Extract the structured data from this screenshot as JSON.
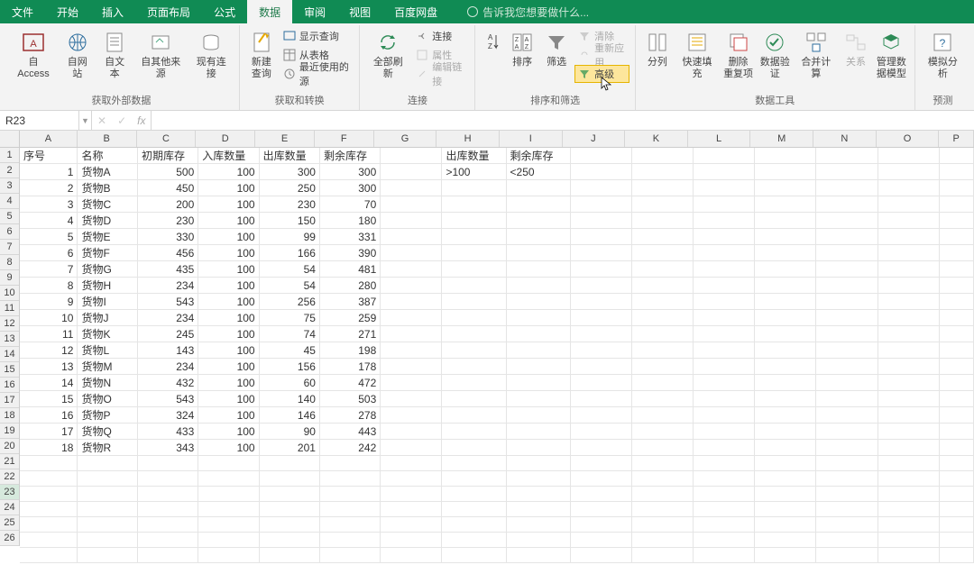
{
  "menu": {
    "file": "文件",
    "home": "开始",
    "insert": "插入",
    "layout": "页面布局",
    "formula": "公式",
    "data": "数据",
    "review": "审阅",
    "view": "视图",
    "baidu": "百度网盘",
    "tell": "告诉我您想要做什么..."
  },
  "ribbon": {
    "ext_data": {
      "access": "自 Access",
      "web": "自网站",
      "text": "自文本",
      "other": "自其他来源",
      "existing": "现有连接",
      "label": "获取外部数据"
    },
    "get_transform": {
      "newquery": "新建\n查询",
      "show": "显示查询",
      "table": "从表格",
      "recent": "最近使用的源",
      "label": "获取和转换"
    },
    "conn": {
      "refresh": "全部刷新",
      "connections": "连接",
      "properties": "属性",
      "editlinks": "编辑链接",
      "label": "连接"
    },
    "sort": {
      "sort": "排序",
      "filter": "筛选",
      "clear": "清除",
      "reapply": "重新应用",
      "advanced": "高级",
      "label": "排序和筛选"
    },
    "tools": {
      "split": "分列",
      "flashfill": "快速填充",
      "dedupe": "删除\n重复项",
      "validation": "数据验\n证",
      "consolidate": "合并计算",
      "relations": "关系",
      "model": "管理数\n据模型",
      "label": "数据工具"
    },
    "forecast": {
      "whatif": "模拟分析",
      "label": "预测"
    }
  },
  "namebox": "R23",
  "columns": [
    "A",
    "B",
    "C",
    "D",
    "E",
    "F",
    "G",
    "H",
    "I",
    "J",
    "K",
    "L",
    "M",
    "N",
    "O",
    "P"
  ],
  "headers": {
    "A": "序号",
    "B": "名称",
    "C": "初期库存",
    "D": "入库数量",
    "E": "出库数量",
    "F": "剩余库存",
    "H": "出库数量",
    "I": "剩余库存"
  },
  "criteria": {
    "H": ">100",
    "I": "<250"
  },
  "rows": [
    {
      "n": 1,
      "name": "货物A",
      "c": 500,
      "d": 100,
      "e": 300,
      "f": 300
    },
    {
      "n": 2,
      "name": "货物B",
      "c": 450,
      "d": 100,
      "e": 250,
      "f": 300
    },
    {
      "n": 3,
      "name": "货物C",
      "c": 200,
      "d": 100,
      "e": 230,
      "f": 70
    },
    {
      "n": 4,
      "name": "货物D",
      "c": 230,
      "d": 100,
      "e": 150,
      "f": 180
    },
    {
      "n": 5,
      "name": "货物E",
      "c": 330,
      "d": 100,
      "e": 99,
      "f": 331
    },
    {
      "n": 6,
      "name": "货物F",
      "c": 456,
      "d": 100,
      "e": 166,
      "f": 390
    },
    {
      "n": 7,
      "name": "货物G",
      "c": 435,
      "d": 100,
      "e": 54,
      "f": 481
    },
    {
      "n": 8,
      "name": "货物H",
      "c": 234,
      "d": 100,
      "e": 54,
      "f": 280
    },
    {
      "n": 9,
      "name": "货物I",
      "c": 543,
      "d": 100,
      "e": 256,
      "f": 387
    },
    {
      "n": 10,
      "name": "货物J",
      "c": 234,
      "d": 100,
      "e": 75,
      "f": 259
    },
    {
      "n": 11,
      "name": "货物K",
      "c": 245,
      "d": 100,
      "e": 74,
      "f": 271
    },
    {
      "n": 12,
      "name": "货物L",
      "c": 143,
      "d": 100,
      "e": 45,
      "f": 198
    },
    {
      "n": 13,
      "name": "货物M",
      "c": 234,
      "d": 100,
      "e": 156,
      "f": 178
    },
    {
      "n": 14,
      "name": "货物N",
      "c": 432,
      "d": 100,
      "e": 60,
      "f": 472
    },
    {
      "n": 15,
      "name": "货物O",
      "c": 543,
      "d": 100,
      "e": 140,
      "f": 503
    },
    {
      "n": 16,
      "name": "货物P",
      "c": 324,
      "d": 100,
      "e": 146,
      "f": 278
    },
    {
      "n": 17,
      "name": "货物Q",
      "c": 433,
      "d": 100,
      "e": 90,
      "f": 443
    },
    {
      "n": 18,
      "name": "货物R",
      "c": 343,
      "d": 100,
      "e": 201,
      "f": 242
    }
  ],
  "selectedRow": 23
}
